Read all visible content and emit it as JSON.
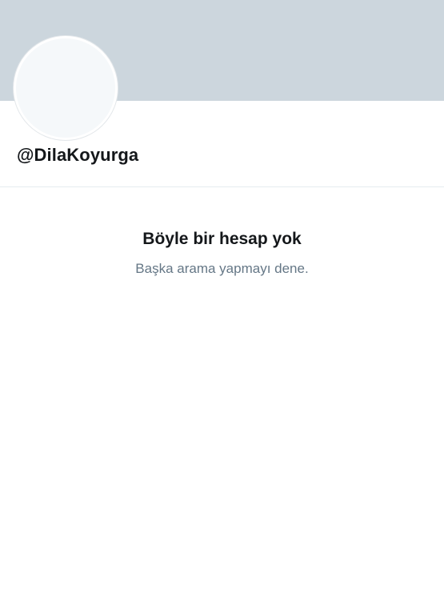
{
  "profile": {
    "handle": "@DilaKoyurga",
    "banner_color": "#ccd6dd",
    "avatar_color": "#f5f8fa"
  },
  "empty_state": {
    "title": "Böyle bir hesap yok",
    "subtitle": "Başka arama yapmayı dene."
  },
  "colors": {
    "text_primary": "#14171a",
    "text_secondary": "#657786",
    "divider": "#e6ecf0"
  }
}
